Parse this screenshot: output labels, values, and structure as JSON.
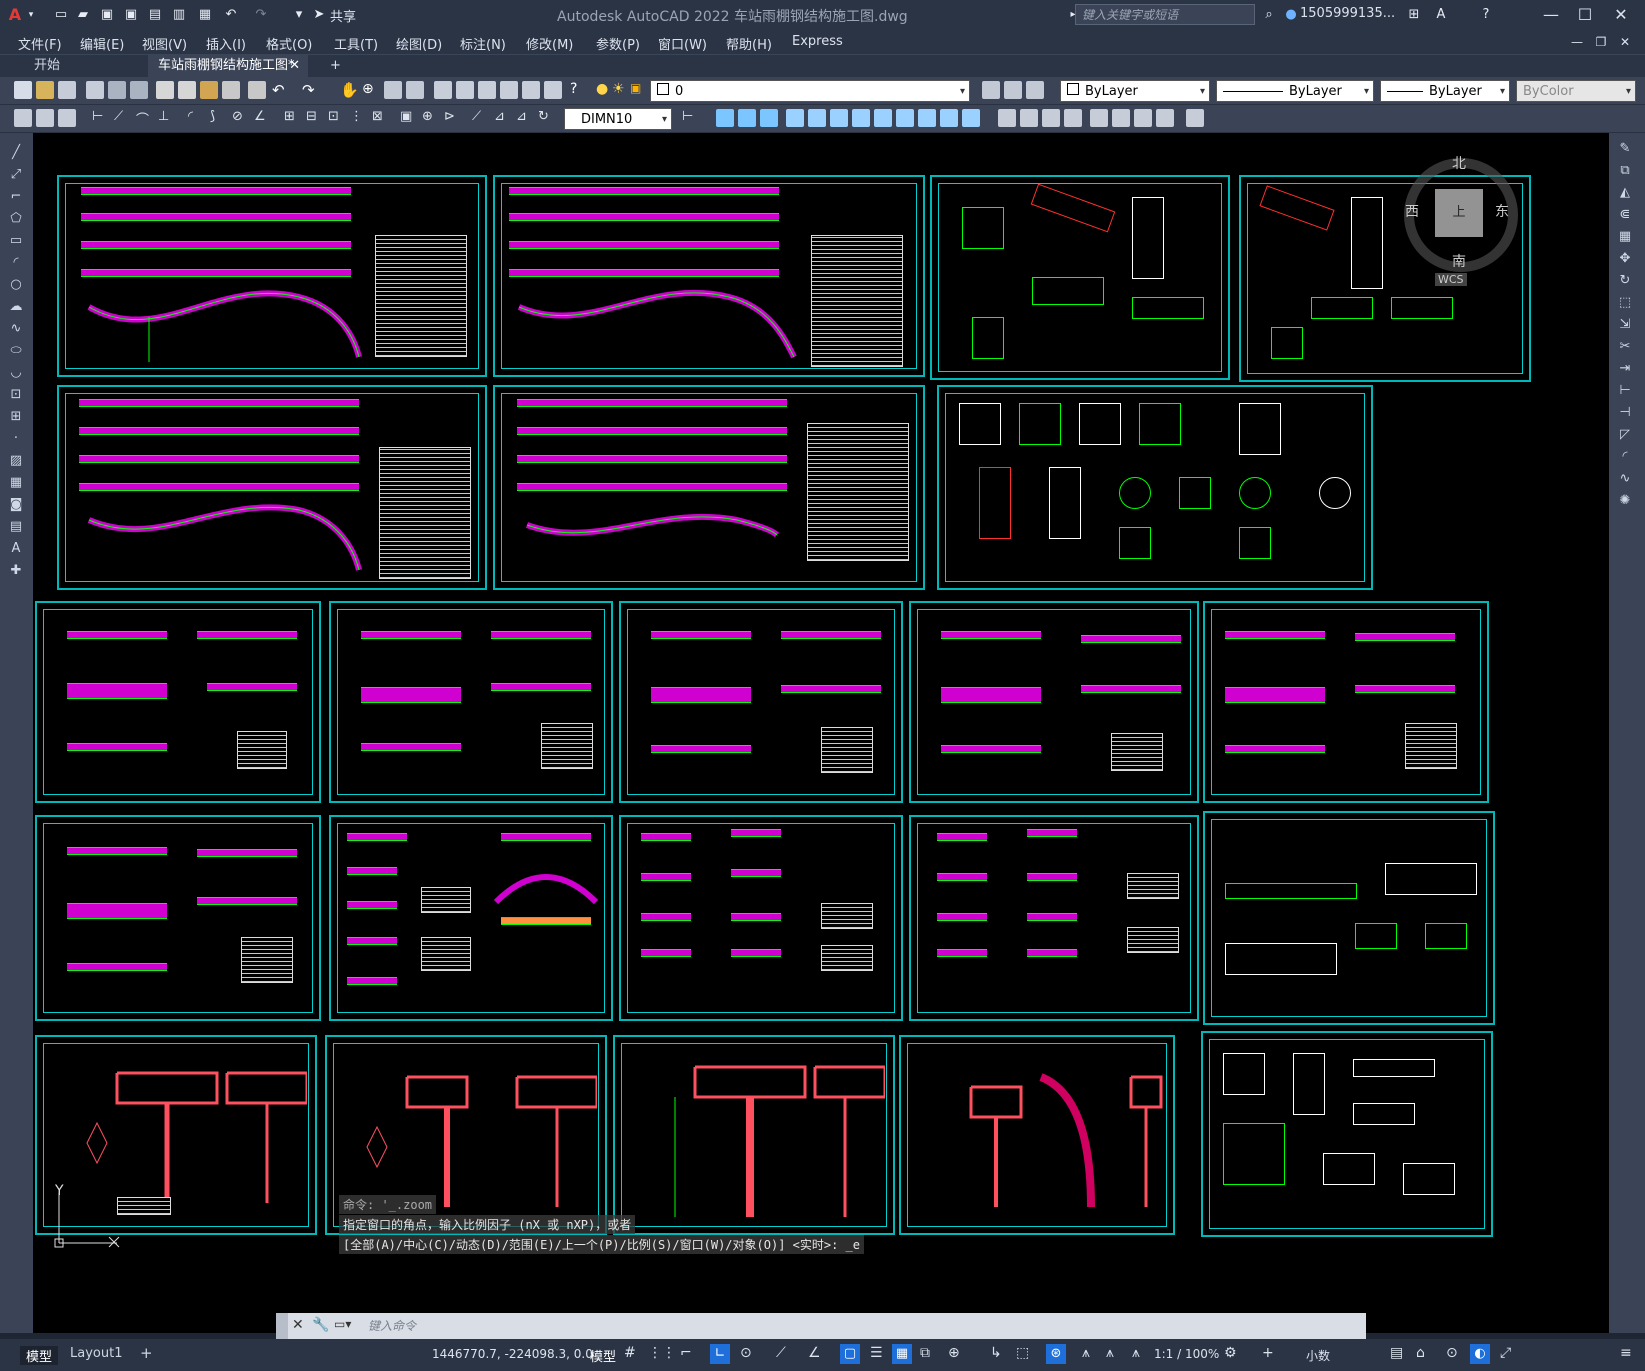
{
  "app": {
    "title": "Autodesk AutoCAD 2022    车站雨棚钢结构施工图.dwg",
    "share_label": "共享",
    "search_placeholder": "键入关键字或短语",
    "user": "1505999135..."
  },
  "menus": [
    "文件(F)",
    "编辑(E)",
    "视图(V)",
    "插入(I)",
    "格式(O)",
    "工具(T)",
    "绘图(D)",
    "标注(N)",
    "修改(M)",
    "参数(P)",
    "窗口(W)",
    "帮助(H)",
    "Express"
  ],
  "tabs": {
    "start": "开始",
    "drawing": "车站雨棚钢结构施工图*",
    "add": "+"
  },
  "layer": {
    "current": "0"
  },
  "properties": {
    "color": "ByLayer",
    "linetype": "ByLayer",
    "lineweight": "ByLayer",
    "plotstyle": "ByColor"
  },
  "dimstyle": "DIMN10",
  "viewcube": {
    "north": "北",
    "south": "南",
    "east": "东",
    "west": "西",
    "top": "上",
    "wcs": "WCS"
  },
  "ucs": {
    "y": "Y"
  },
  "command_history": [
    "命令: '_.zoom",
    "指定窗口的角点，输入比例因子 (nX 或 nXP)，或者",
    "[全部(A)/中心(C)/动态(D)/范围(E)/上一个(P)/比例(S)/窗口(W)/对象(O)] <实时>: _e"
  ],
  "command_placeholder": "键入命令",
  "layout_tabs": [
    "模型",
    "Layout1"
  ],
  "status": {
    "coords": "1446770.7, -224098.3, 0.0",
    "space": "模型",
    "scale": "1:1 / 100%",
    "units": "小数"
  },
  "colors": {
    "canvas": "#000000",
    "frame": "#00c8c8",
    "member": "#d000d0",
    "line": "#00ff00",
    "chrome": "#2b3445"
  }
}
